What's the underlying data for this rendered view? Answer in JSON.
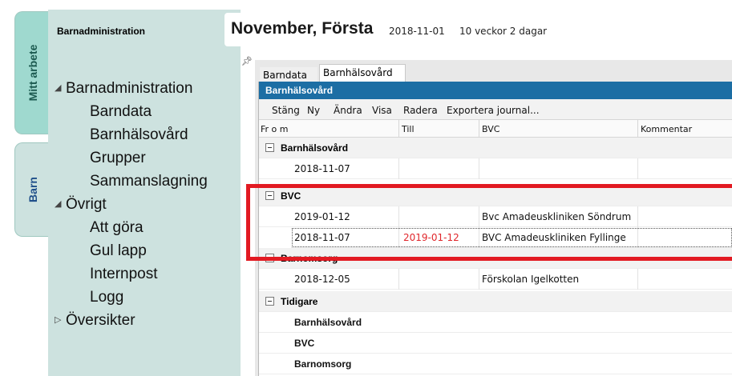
{
  "side_tabs": [
    {
      "label": "Mitt arbete"
    },
    {
      "label": "Barn"
    }
  ],
  "nav": {
    "title": "Barnadministration",
    "tree": [
      {
        "label": "Barnadministration",
        "arrow": "◢"
      },
      {
        "label": "Barndata"
      },
      {
        "label": "Barnhälsovård"
      },
      {
        "label": "Grupper"
      },
      {
        "label": "Sammanslagning"
      },
      {
        "label": "Övrigt",
        "arrow": "◢"
      },
      {
        "label": "Att göra"
      },
      {
        "label": "Gul lapp"
      },
      {
        "label": "Internpost"
      },
      {
        "label": "Logg"
      },
      {
        "label": "Översikter",
        "arrow": "▷"
      }
    ]
  },
  "header": {
    "name": "November, Första",
    "date": "2018-11-01",
    "age": "10 veckor 2 dagar"
  },
  "tabs": [
    {
      "label": "Barndata"
    },
    {
      "label": "Barnhälsovård"
    }
  ],
  "panel": {
    "title": "Barnhälsovård",
    "toolbar": [
      "Stäng",
      "Ny",
      "Ändra",
      "Visa",
      "Radera",
      "Exportera journal..."
    ]
  },
  "columns": [
    "Fr o m",
    "Till",
    "BVC",
    "Kommentar"
  ],
  "groups": {
    "g1": "Barnhälsovård",
    "g2": "BVC",
    "g3": "Barnomsorg",
    "g4": "Tidigare"
  },
  "rows": {
    "r1": {
      "from": "2018-11-07",
      "to": "",
      "bvc": "",
      "comment": ""
    },
    "r2": {
      "from": "2019-01-12",
      "to": "",
      "bvc": "Bvc Amadeuskliniken Söndrum",
      "comment": ""
    },
    "r3": {
      "from": "2018-11-07",
      "to": "2019-01-12",
      "bvc": "BVC Amadeuskliniken Fyllinge",
      "comment": ""
    },
    "r4": {
      "from": "2018-12-05",
      "to": "",
      "bvc": "Förskolan Igelkotten",
      "comment": ""
    }
  },
  "tidigare": [
    "Barnhälsovård",
    "BVC",
    "Barnomsorg"
  ],
  "colors": {
    "accent": "#1c6ea4",
    "nav_bg": "#cde2df",
    "highlight": "#e21a22",
    "end_date": "#e0262b"
  }
}
